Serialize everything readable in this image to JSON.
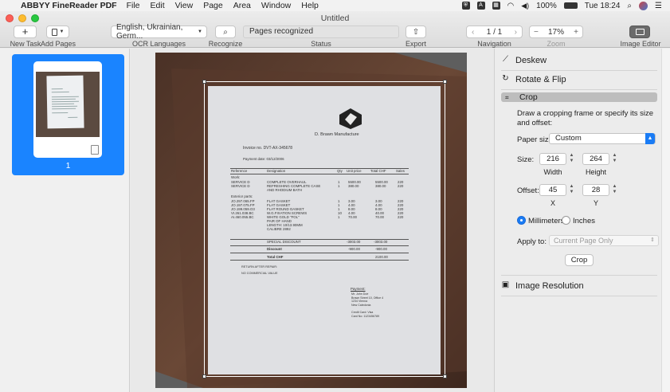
{
  "menubar": {
    "app_name": "ABBYY FineReader PDF",
    "menus": [
      "File",
      "Edit",
      "View",
      "Page",
      "Area",
      "Window",
      "Help"
    ],
    "battery": "100%",
    "clock": "Tue 18:24"
  },
  "window": {
    "title": "Untitled"
  },
  "toolbar": {
    "new_task_label": "New Task",
    "add_pages_label": "Add Pages",
    "ocr_languages_value": "English, Ukrainian, Germ...",
    "ocr_languages_label": "OCR Languages",
    "recognize_label": "Recognize",
    "status_value": "Pages recognized",
    "status_label": "Status",
    "export_label": "Export",
    "page_counter": "1 / 1",
    "navigation_label": "Navigation",
    "zoom_value": "17%",
    "zoom_label": "Zoom",
    "image_editor_label": "Image Editor"
  },
  "thumbnails": [
    {
      "number": "1"
    }
  ],
  "invoice": {
    "company": "D. Brawn Manufacture",
    "invoice_no": "Invoice no. DVT-AX-345678",
    "payment_date": "Payment date: 03/12/2006",
    "headers": [
      "Reference",
      "Designation",
      "Qty",
      "Unit price",
      "Total CHF",
      "Sales"
    ],
    "work_label": "Work:",
    "work_rows": [
      [
        "SERVICE D",
        "COMPLETE OVERHAUL",
        "1",
        "5500.00",
        "5500.00",
        "220"
      ],
      [
        "SERVICE D",
        "REFRESHING COMPLETE CASE",
        "1",
        "380.00",
        "380.00",
        "220"
      ],
      [
        "",
        "AND RHODIUM BATH",
        "",
        "",
        "",
        ""
      ]
    ],
    "parts_label": "Exterior parts:",
    "part_rows": [
      [
        "JO.297.065.FP",
        "FLAT GASKET",
        "1",
        "3.00",
        "3.00",
        "220"
      ],
      [
        "JO.197.075.FP",
        "FLAT GASKET",
        "1",
        "4.00",
        "4.00",
        "220"
      ],
      [
        "JO.199.059.O3",
        "FLAT ROUND GASKET",
        "1",
        "8.00",
        "8.00",
        "220"
      ],
      [
        "VI.261.038.BC",
        "W.G.FIXATION SCREWS",
        "10",
        "4.00",
        "40.00",
        "220"
      ],
      [
        "AI.460.055.BC",
        "WHITE GOLD \"FOL\"",
        "1",
        "70.00",
        "70.00",
        "220"
      ],
      [
        "",
        "PAIR OF HAND",
        "",
        "",
        "",
        ""
      ],
      [
        "",
        "LENGTH: 10/13.90MM",
        "",
        "",
        "",
        ""
      ],
      [
        "",
        "CALIBRE 2892",
        "",
        "",
        "",
        ""
      ]
    ],
    "special_discount": [
      "SPECIAL DISCOUNT",
      "-3003.00",
      "-3003.00"
    ],
    "discount": [
      "Discount",
      "-900.00",
      "-900.00"
    ],
    "total": [
      "Total CHF",
      "2100.00"
    ],
    "return_note": "RETURN AFTER REPAIR:",
    "commercial_note": "NO COMMERCIAL VALUE",
    "payment_title": "Payment:",
    "payment_lines": [
      "Mr. John Doe",
      "Brawn Street 10, Office 4",
      "1234 Vienna",
      "New Caledonia",
      "",
      "Credit Card: Visa",
      "Card No: 1123456789"
    ]
  },
  "settings": {
    "deskew_label": "Deskew",
    "rotate_flip_label": "Rotate & Flip",
    "crop_label": "Crop",
    "crop_description": "Draw a cropping frame or specify its size and offset:",
    "paper_size_label": "Paper size:",
    "paper_size_value": "Custom",
    "size_label": "Size:",
    "width_value": "216",
    "height_value": "264",
    "width_label": "Width",
    "height_label": "Height",
    "offset_label": "Offset:",
    "offset_x_value": "45",
    "offset_y_value": "28",
    "x_label": "X",
    "y_label": "Y",
    "unit_millimeters": "Millimeters",
    "unit_inches": "Inches",
    "apply_to_label": "Apply to:",
    "apply_to_value": "Current Page Only",
    "crop_button_label": "Crop",
    "image_resolution_label": "Image Resolution"
  }
}
